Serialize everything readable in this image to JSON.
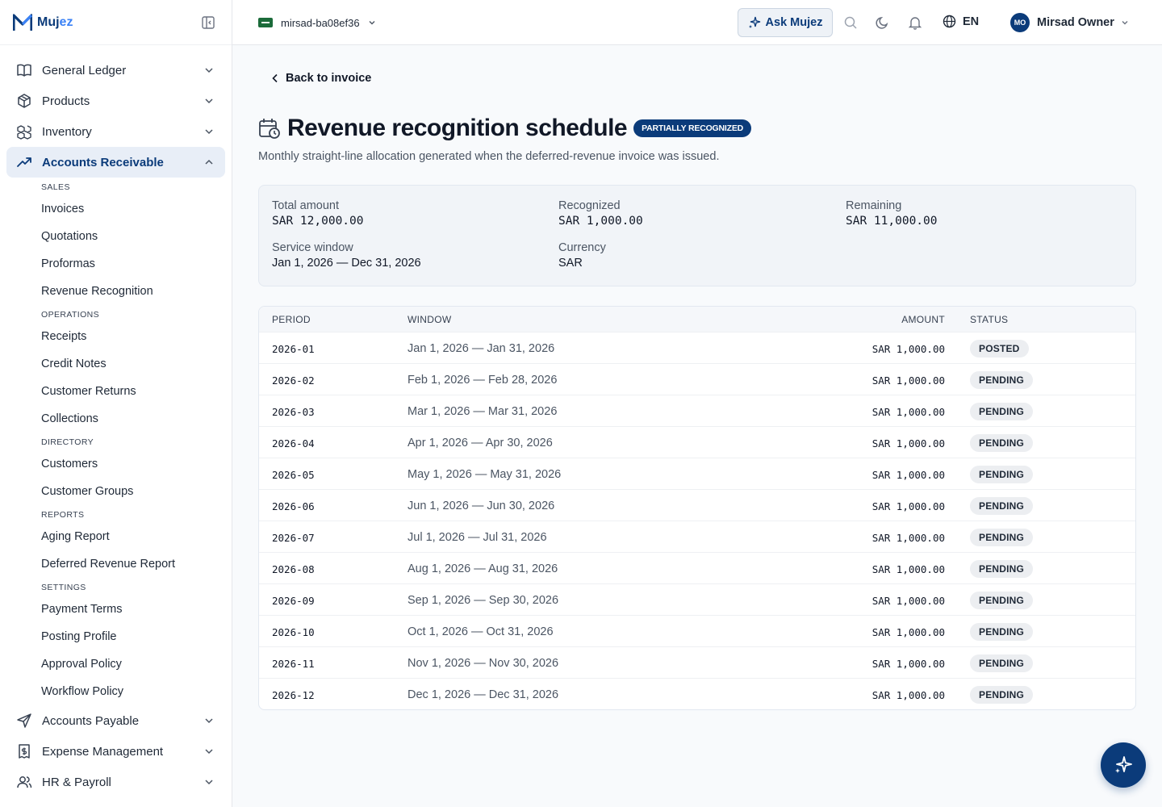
{
  "brand": {
    "name_prefix": "Muj",
    "name_suffix": "ez"
  },
  "sidebar": {
    "top_items": [
      {
        "label": "General Ledger",
        "icon": "book-open-icon"
      },
      {
        "label": "Products",
        "icon": "package-icon"
      },
      {
        "label": "Inventory",
        "icon": "boxes-icon"
      },
      {
        "label": "Accounts Receivable",
        "icon": "trending-up-icon",
        "active": true
      }
    ],
    "sections": [
      {
        "title": "SALES",
        "items": [
          "Invoices",
          "Quotations",
          "Proformas",
          "Revenue Recognition"
        ]
      },
      {
        "title": "OPERATIONS",
        "items": [
          "Receipts",
          "Credit Notes",
          "Customer Returns",
          "Collections"
        ]
      },
      {
        "title": "DIRECTORY",
        "items": [
          "Customers",
          "Customer Groups"
        ]
      },
      {
        "title": "REPORTS",
        "items": [
          "Aging Report",
          "Deferred Revenue Report"
        ]
      },
      {
        "title": "SETTINGS",
        "items": [
          "Payment Terms",
          "Posting Profile",
          "Approval Policy",
          "Workflow Policy"
        ]
      }
    ],
    "bottom_items": [
      {
        "label": "Accounts Payable",
        "icon": "send-icon"
      },
      {
        "label": "Expense Management",
        "icon": "receipt-dollar-icon"
      },
      {
        "label": "HR & Payroll",
        "icon": "users-icon"
      }
    ]
  },
  "topbar": {
    "org_name": "mirsad-ba08ef36",
    "ask_label": "Ask Mujez",
    "lang": "EN",
    "user_initials": "MO",
    "user_name": "Mirsad Owner"
  },
  "page": {
    "back_label": "Back to invoice",
    "title": "Revenue recognition schedule",
    "status_badge": "PARTIALLY RECOGNIZED",
    "subtitle": "Monthly straight-line allocation generated when the deferred-revenue invoice was issued."
  },
  "summary": {
    "total_label": "Total amount",
    "total_value": "SAR 12,000.00",
    "recognized_label": "Recognized",
    "recognized_value": "SAR 1,000.00",
    "remaining_label": "Remaining",
    "remaining_value": "SAR 11,000.00",
    "window_label": "Service window",
    "window_value": "Jan 1, 2026 — Dec 31, 2026",
    "currency_label": "Currency",
    "currency_value": "SAR"
  },
  "table": {
    "headers": {
      "period": "PERIOD",
      "window": "WINDOW",
      "amount": "AMOUNT",
      "status": "STATUS"
    },
    "rows": [
      {
        "period": "2026-01",
        "window": "Jan 1, 2026 — Jan 31, 2026",
        "amount": "SAR 1,000.00",
        "status": "POSTED"
      },
      {
        "period": "2026-02",
        "window": "Feb 1, 2026 — Feb 28, 2026",
        "amount": "SAR 1,000.00",
        "status": "PENDING"
      },
      {
        "period": "2026-03",
        "window": "Mar 1, 2026 — Mar 31, 2026",
        "amount": "SAR 1,000.00",
        "status": "PENDING"
      },
      {
        "period": "2026-04",
        "window": "Apr 1, 2026 — Apr 30, 2026",
        "amount": "SAR 1,000.00",
        "status": "PENDING"
      },
      {
        "period": "2026-05",
        "window": "May 1, 2026 — May 31, 2026",
        "amount": "SAR 1,000.00",
        "status": "PENDING"
      },
      {
        "period": "2026-06",
        "window": "Jun 1, 2026 — Jun 30, 2026",
        "amount": "SAR 1,000.00",
        "status": "PENDING"
      },
      {
        "period": "2026-07",
        "window": "Jul 1, 2026 — Jul 31, 2026",
        "amount": "SAR 1,000.00",
        "status": "PENDING"
      },
      {
        "period": "2026-08",
        "window": "Aug 1, 2026 — Aug 31, 2026",
        "amount": "SAR 1,000.00",
        "status": "PENDING"
      },
      {
        "period": "2026-09",
        "window": "Sep 1, 2026 — Sep 30, 2026",
        "amount": "SAR 1,000.00",
        "status": "PENDING"
      },
      {
        "period": "2026-10",
        "window": "Oct 1, 2026 — Oct 31, 2026",
        "amount": "SAR 1,000.00",
        "status": "PENDING"
      },
      {
        "period": "2026-11",
        "window": "Nov 1, 2026 — Nov 30, 2026",
        "amount": "SAR 1,000.00",
        "status": "PENDING"
      },
      {
        "period": "2026-12",
        "window": "Dec 1, 2026 — Dec 31, 2026",
        "amount": "SAR 1,000.00",
        "status": "PENDING"
      }
    ]
  },
  "colors": {
    "brand": "#0b3b7a",
    "accent": "#3b82f6",
    "active_bg": "#e8eef7"
  }
}
